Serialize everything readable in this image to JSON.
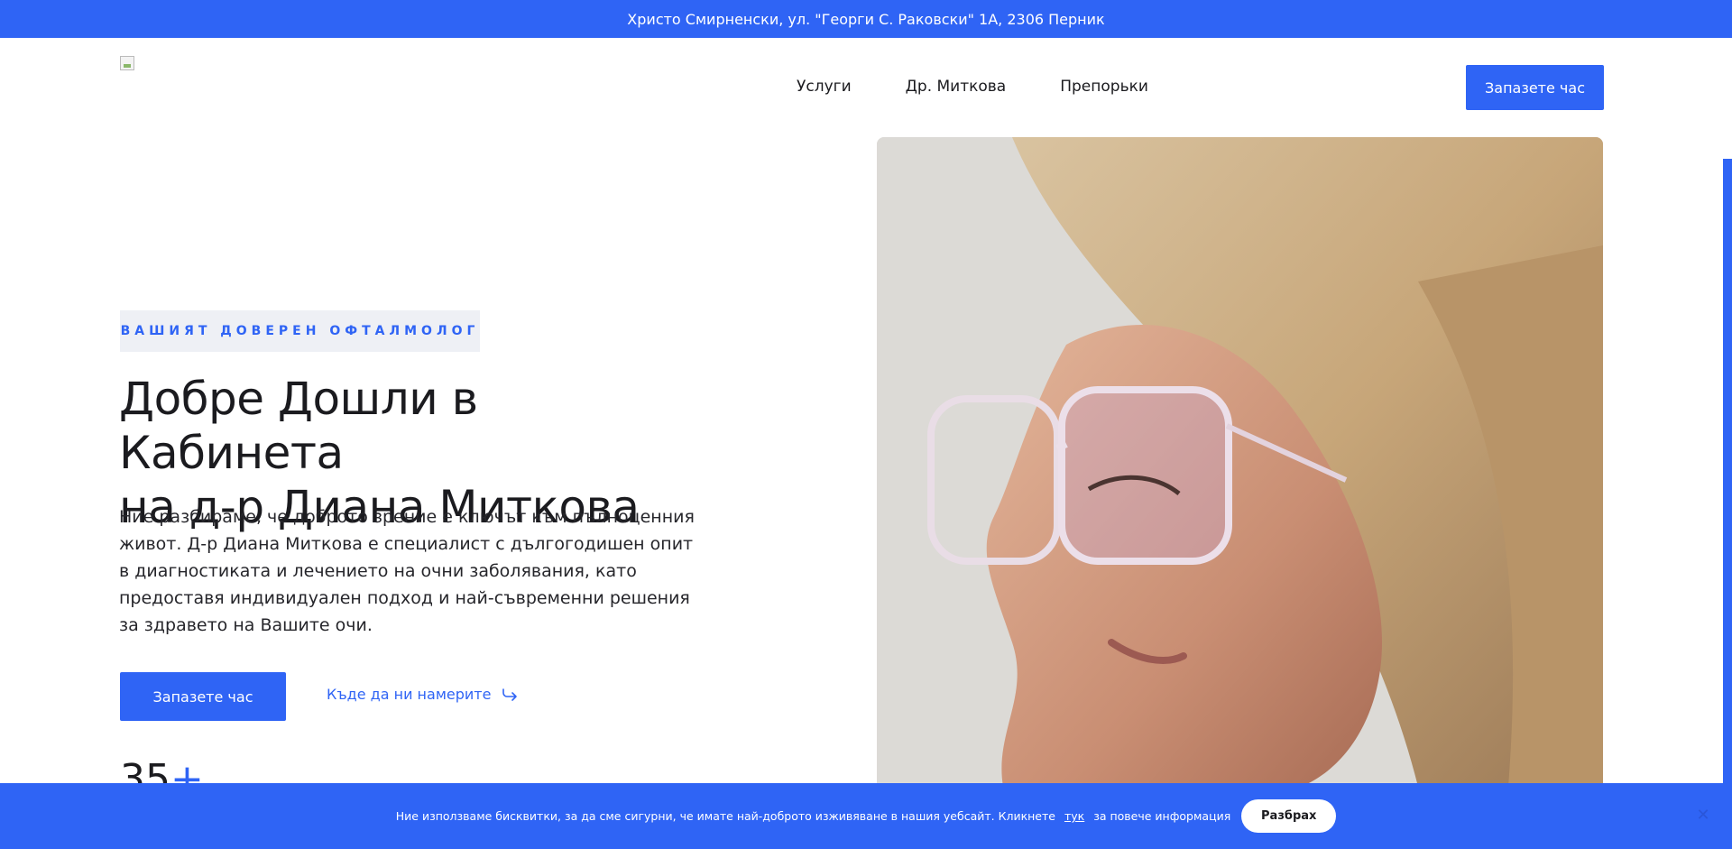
{
  "topbar": {
    "address": "Христо Смирненски, ул. \"Георги С. Раковски\" 1А, 2306 Перник"
  },
  "header": {
    "logo_alt": "",
    "nav": [
      {
        "label": "Услуги"
      },
      {
        "label": "Др. Миткова"
      },
      {
        "label": "Препорьки"
      }
    ],
    "cta_label": "Запазете час"
  },
  "hero": {
    "eyebrow": "ВАШИЯТ ДОВЕРЕН ОФТАЛМОЛОГ",
    "title_line1": "Добре Дошли в Кабинета",
    "title_line2": "на д-р Диана Миткова",
    "text": "Ние разбираме, че доброто зрение е ключът към пълноценния живот. Д-р Диана Миткова е специалист с дългогодишен опит в диагностиката и лечението на очни заболявания, като предоставя индивидуален подход и най-съвременни решения за здравето на Вашите очи.",
    "cta_label": "Запазете час",
    "find_label": "Къде да ни намерите",
    "stat_value": "35",
    "stat_suffix": "+"
  },
  "cookie": {
    "text_before": "Ние използваме бисквитки, за да сме сигурни, че имате най-доброто изживяване в нашия уебсайт. Кликнете",
    "link": "тук",
    "text_after": "за повече информация",
    "accept_label": "Разбрах",
    "close_icon": "close-icon"
  },
  "colors": {
    "accent": "#2f64f5",
    "text": "#1b1b1f",
    "eyebrow_bg": "#eef0f5"
  }
}
